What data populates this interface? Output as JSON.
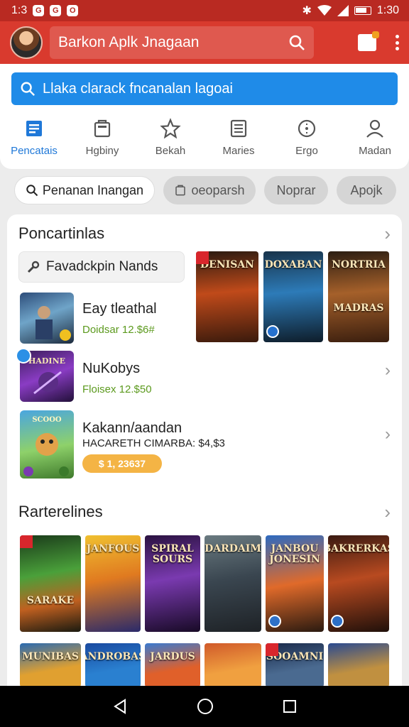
{
  "status_bar": {
    "time": "1:3",
    "right_time": "1:30",
    "notifications": [
      "G",
      "G",
      "O"
    ]
  },
  "app_bar": {
    "search_text": "Barkon Aplk Jnagaan"
  },
  "blue_search": {
    "text": "Llaka clarack fncanalan lagoai"
  },
  "nav": [
    {
      "label": "Pencatais",
      "icon": "store-icon",
      "active": true
    },
    {
      "label": "Hgbiny",
      "icon": "bag-icon",
      "active": false
    },
    {
      "label": "Bekah",
      "icon": "star-icon",
      "active": false
    },
    {
      "label": "Maries",
      "icon": "list-icon",
      "active": false
    },
    {
      "label": "Ergo",
      "icon": "compass-icon",
      "active": false
    },
    {
      "label": "Madan",
      "icon": "profile-icon",
      "active": false
    }
  ],
  "chips": [
    {
      "label": "Penanan Inangan",
      "icon": "search-icon"
    },
    {
      "label": "oeoparsh",
      "icon": "bag-icon"
    },
    {
      "label": "Noprar"
    },
    {
      "label": "Apojk"
    }
  ],
  "section1": {
    "title": "Poncartinlas",
    "tag": "Favadckpin Nands",
    "games": [
      {
        "name": "Eay tleathal",
        "sub": "Doidsar 12.$6#",
        "sub_color": "#5c9a1e"
      },
      {
        "name": "NuKobys",
        "sub": "Floisex 12.$50",
        "sub_color": "#5c9a1e"
      },
      {
        "name": "Kakann/aandan",
        "sub": "HACARETH CIMARBA: $4,$3",
        "sub_color": "#222222",
        "badge": "$ 1, 23637"
      }
    ],
    "posters": [
      {
        "title": "DENISAN"
      },
      {
        "title": "DOXABAN"
      },
      {
        "title": "NORTRIA",
        "label": "MADRAS"
      }
    ]
  },
  "section2": {
    "title": "Rarterelines",
    "posters_row1": [
      {
        "title": "",
        "label": "SARAKE"
      },
      {
        "title": "JANFOUS"
      },
      {
        "title": "SPIRAL SOURS"
      },
      {
        "title": "DARDAIM"
      },
      {
        "title": "JANBOU JONESIN"
      },
      {
        "title": "BAKRERKAS"
      }
    ],
    "posters_row2": [
      {
        "title": "MUNIBAS"
      },
      {
        "title": "ANDROBAS"
      },
      {
        "title": "JARDUS"
      },
      {
        "title": ""
      },
      {
        "title": "SOOAMNI"
      },
      {
        "title": ""
      }
    ]
  },
  "colors": {
    "appbar": "#d93a2e",
    "statusbar": "#b92a22",
    "accent_blue": "#1f8be8",
    "active_nav": "#1f78d8"
  }
}
